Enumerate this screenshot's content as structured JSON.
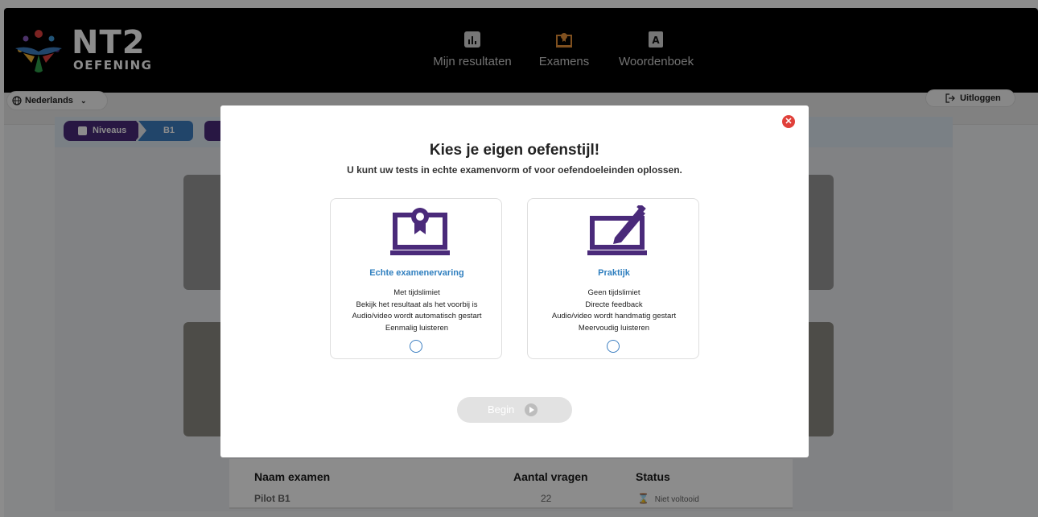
{
  "header": {
    "logo_title": "NT2",
    "logo_subtitle": "OEFENING",
    "nav": [
      {
        "label": "Mijn resultaten",
        "icon": "bar-chart-icon"
      },
      {
        "label": "Examens",
        "icon": "exam-certificate-icon"
      },
      {
        "label": "Woordenboek",
        "icon": "dictionary-icon"
      }
    ]
  },
  "subbar": {
    "language": "Nederlands",
    "logout": "Uitloggen"
  },
  "breadcrumb": [
    "Niveaus",
    "B1"
  ],
  "table": {
    "headers": [
      "Naam examen",
      "Aantal vragen",
      "Status"
    ],
    "rows": [
      {
        "name": "Pilot B1",
        "count": "22",
        "status": "Niet voltooid"
      }
    ]
  },
  "modal": {
    "title": "Kies je eigen oefenstijl!",
    "subtitle": "U kunt uw tests in echte examenvorm of voor oefendoeleinden oplossen.",
    "options": [
      {
        "title": "Echte examenervaring",
        "lines": [
          "Met tijdslimiet",
          "Bekijk het resultaat als het voorbij is",
          "Audio/video wordt automatisch gestart",
          "Eenmalig luisteren"
        ],
        "icon": "laptop-certificate-icon"
      },
      {
        "title": "Praktijk",
        "lines": [
          "Geen tijdslimiet",
          "Directe feedback",
          "Audio/video wordt handmatig gestart",
          "Meervoudig luisteren"
        ],
        "icon": "laptop-pen-icon"
      }
    ],
    "begin_label": "Begin"
  },
  "colors": {
    "purple": "#4a2a7a",
    "blue": "#3d7fc1",
    "close_red": "#e0403a"
  }
}
